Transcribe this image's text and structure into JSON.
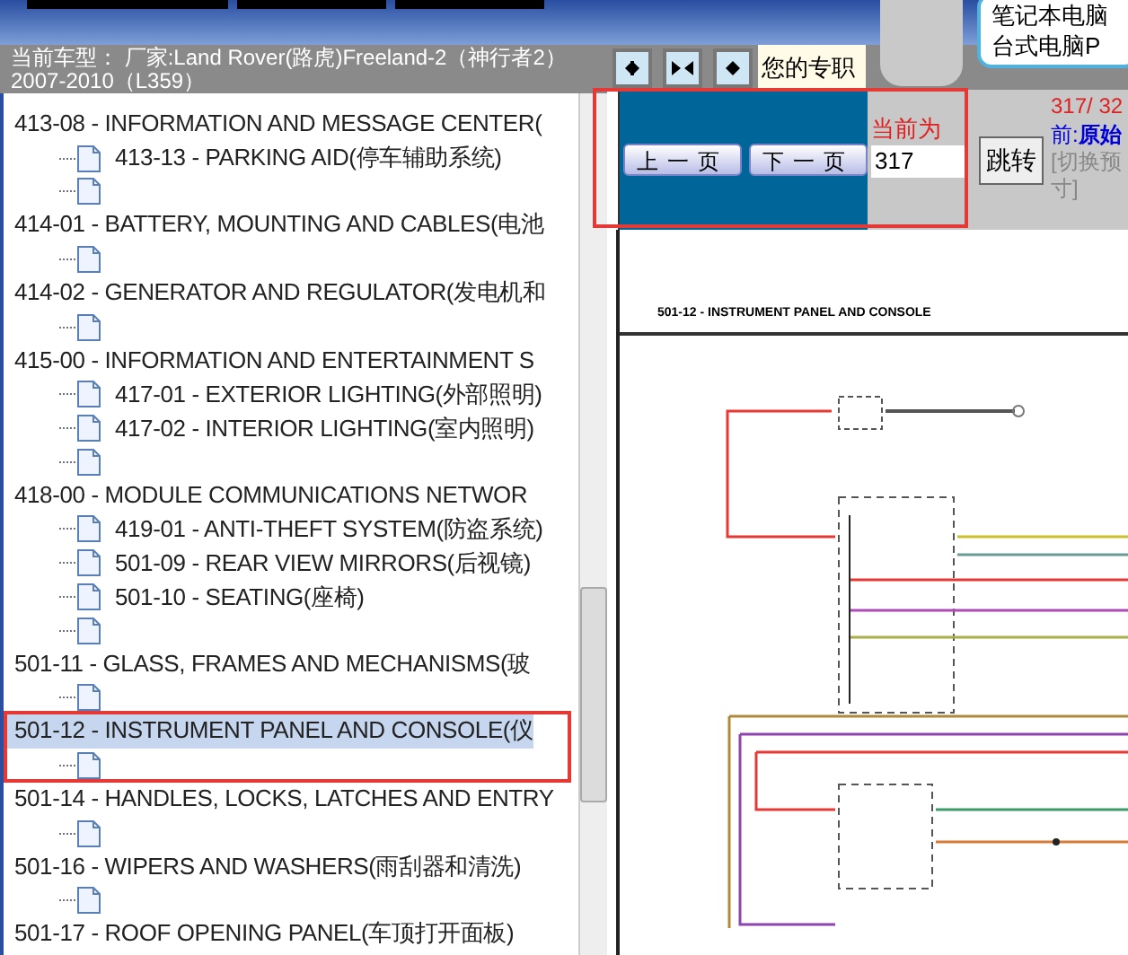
{
  "banner": {
    "lines": [
      "笔记本电脑",
      "台式电脑P"
    ]
  },
  "car_model": "当前车型： 厂家:Land Rover(路虎)Freeland-2（神行者2）2007-2010（L359）",
  "nav_buttons": [
    {
      "kind": "last"
    },
    {
      "kind": "fit"
    },
    {
      "kind": "prev"
    }
  ],
  "notice": "您的专职",
  "pager": {
    "highlighted": true,
    "prev": "上一页",
    "next": "下一页",
    "current_label": "当前为",
    "page_input": "317",
    "jump": "跳转",
    "page_count": "317/ 32",
    "view_mode": "前:**原始**",
    "switch_hint": "[切换预",
    "switch_hint_end": "寸]"
  },
  "tree": [
    {
      "label": "413-08 - INFORMATION AND MESSAGE CENTER(",
      "selected": false,
      "highlighted": false,
      "children": [
        {
          "kind": "page",
          "label": "413-13 - PARKING AID(停车辅助系统)"
        },
        {
          "kind": "blank"
        }
      ]
    },
    {
      "label": "414-01 - BATTERY, MOUNTING AND CABLES(电池",
      "selected": false,
      "highlighted": false,
      "children": [
        {
          "kind": "blank"
        }
      ]
    },
    {
      "label": "414-02 - GENERATOR AND REGULATOR(发电机和",
      "selected": false,
      "highlighted": false,
      "children": [
        {
          "kind": "blank"
        }
      ]
    },
    {
      "label": "415-00 - INFORMATION AND ENTERTAINMENT S",
      "selected": false,
      "highlighted": false,
      "children": [
        {
          "kind": "page",
          "label": "417-01 - EXTERIOR LIGHTING(外部照明)"
        },
        {
          "kind": "page",
          "label": "417-02 - INTERIOR LIGHTING(室内照明)"
        },
        {
          "kind": "blank"
        }
      ]
    },
    {
      "label": "418-00 - MODULE COMMUNICATIONS NETWOR",
      "selected": false,
      "highlighted": false,
      "children": [
        {
          "kind": "page",
          "label": "419-01 - ANTI-THEFT SYSTEM(防盗系统)"
        },
        {
          "kind": "page",
          "label": "501-09 - REAR VIEW MIRRORS(后视镜)"
        },
        {
          "kind": "page",
          "label": "501-10 - SEATING(座椅)"
        },
        {
          "kind": "blank"
        }
      ]
    },
    {
      "label": "501-11 - GLASS, FRAMES AND MECHANISMS(玻",
      "selected": false,
      "highlighted": false,
      "children": [
        {
          "kind": "blank"
        }
      ]
    },
    {
      "label": "501-12 - INSTRUMENT PANEL AND CONSOLE(仪",
      "selected": true,
      "highlighted": true,
      "children": [
        {
          "kind": "blank"
        }
      ]
    },
    {
      "label": "501-14 - HANDLES, LOCKS, LATCHES AND ENTRY",
      "selected": false,
      "highlighted": false,
      "children": [
        {
          "kind": "blank"
        }
      ]
    },
    {
      "label": "501-16 - WIPERS AND WASHERS(雨刮器和清洗)",
      "selected": false,
      "highlighted": false,
      "children": [
        {
          "kind": "blank"
        }
      ]
    },
    {
      "label": "501-17 - ROOF OPENING PANEL(车顶打开面板)",
      "selected": false,
      "highlighted": false
    }
  ],
  "document": {
    "heading": "501-12 - INSTRUMENT PANEL AND CONSOLE"
  }
}
